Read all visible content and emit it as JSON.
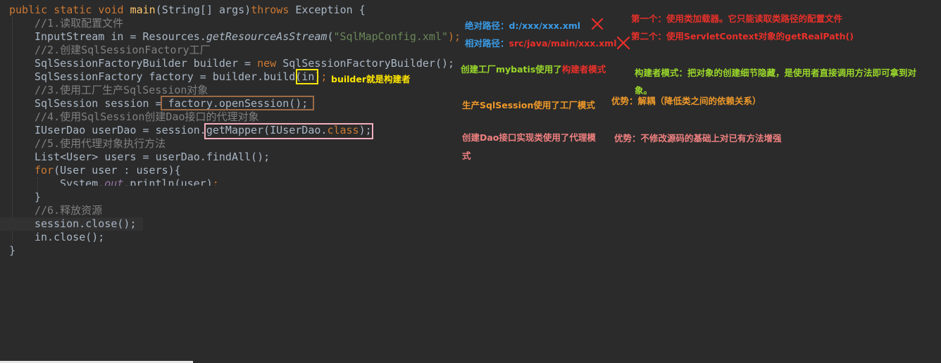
{
  "code": {
    "line1": {
      "kw1": "public static void ",
      "fn": "main",
      "rest": "(String[] args)",
      "kw2": "throws",
      "tail": " Exception {"
    },
    "line2": {
      "comment": "//1.读取配置文件"
    },
    "line3": {
      "a": "InputStream in = Resources.",
      "method": "getResourceAsStream",
      "b": "(",
      "str": "\"SqlMapConfig.xml\"",
      "c": ");"
    },
    "line4": {
      "comment": "//2.创建SqlSessionFactory工厂"
    },
    "line5": {
      "a": "SqlSessionFactoryBuilder builder = ",
      "kw": "new",
      "b": " SqlSessionFactoryBuilder();"
    },
    "line6": {
      "a": "SqlSessionFactory factory = builder.build(",
      "arg": "in",
      "b": ");"
    },
    "line7": {
      "comment": "//3.使用工厂生产SqlSession对象"
    },
    "line8": {
      "a": "SqlSession session = ",
      "b": "factory.openSession();"
    },
    "line9": {
      "comment": "//4.使用SqlSession创建Dao接口的代理对象"
    },
    "line10": {
      "a": "IUserDao userDao = session.",
      "b": "getMapper(IUserDao.",
      "kw": "class",
      "c": ");"
    },
    "line11": {
      "comment": "//5.使用代理对象执行方法"
    },
    "line12": {
      "a": "List<User> users = userDao.findAll();"
    },
    "line13": {
      "kw": "for",
      "a": "(User user : users){"
    },
    "line14": {
      "a": "System.",
      "field": "out",
      "b": ".println(user)",
      "c": ";"
    },
    "line15": {
      "a": "}"
    },
    "line16": {
      "comment": "//6.释放资源"
    },
    "line17": {
      "a": "session.close();"
    },
    "line18": {
      "a": "in.close();"
    },
    "line19": {
      "a": "}"
    }
  },
  "notes": {
    "abs_label": "绝对路径：",
    "abs_value": "d:/xxx/xxx.xml",
    "rel_label": "相对路径：",
    "rel_value": "src/java/main/xxx.xml",
    "first": "第一个：使用类加载器。它只能读取类路径的配置文件",
    "second": "第二个：使用ServletContext对象的getRealPath()",
    "builder_note": "builder就是构建者",
    "factory_prefix": "创建工厂mybatis使用了",
    "factory_pattern": "构建者模式",
    "builder_pattern_desc": "构建者模式：把对象的创建细节隐藏，是使用者直接调用方法即可拿到对象。",
    "session_factory": "生产SqlSession使用了工厂模式",
    "factory_advantage": "优势：解耦（降低类之间的依赖关系）",
    "proxy_note": "创建Dao接口实现类使用了代理模式",
    "proxy_advantage": "优势：不修改源码的基础上对已有方法增强"
  },
  "icons": {
    "cross": "cross-mark-icon"
  },
  "colors": {
    "background": "#2b2b2b",
    "keyword": "#cc7832",
    "method": "#ffc66d",
    "comment": "#808080",
    "string": "#6a8759",
    "text": "#a9b7c6",
    "note_blue": "#3a9be6",
    "note_red": "#e8302a",
    "note_yellow": "#ffe600",
    "note_green": "#9ad82a",
    "note_pink": "#f08080",
    "note_orange": "#f09a2a",
    "box_yellow": "#f5e50c",
    "box_brown": "#9c6a45",
    "box_pink": "#f3b0bd"
  }
}
